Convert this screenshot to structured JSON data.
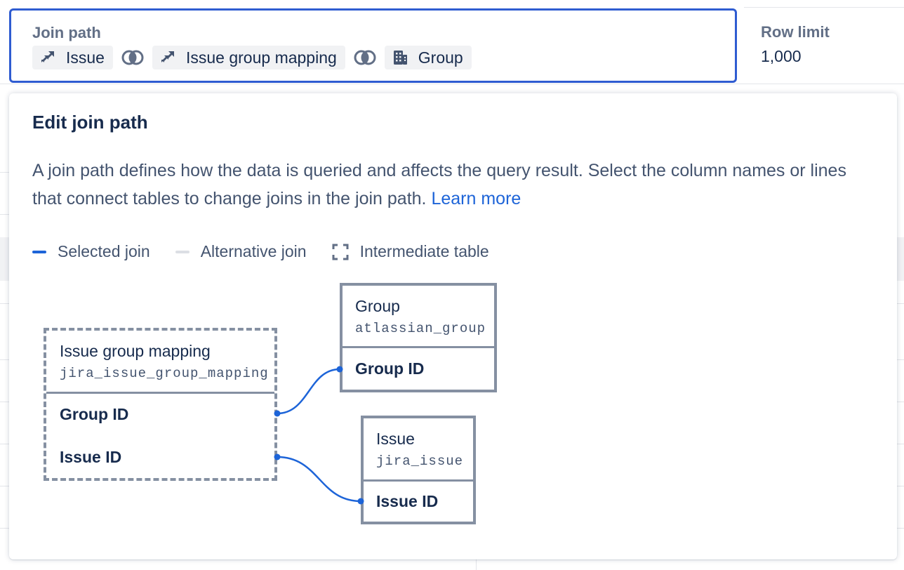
{
  "toolbar": {
    "join_path_label": "Join path",
    "chips": [
      {
        "label": "Issue",
        "icon": "jira-icon"
      },
      {
        "label": "Issue group mapping",
        "icon": "jira-icon"
      },
      {
        "label": "Group",
        "icon": "building-icon"
      }
    ],
    "row_limit_label": "Row limit",
    "row_limit_value": "1,000"
  },
  "popup": {
    "title": "Edit join path",
    "description": "A join path defines how the data is queried and affects the query result. Select the column names or lines that connect tables to change joins in the join path.",
    "learn_more": "Learn more",
    "legend": {
      "selected": "Selected join",
      "alternative": "Alternative join",
      "intermediate": "Intermediate table"
    }
  },
  "diagram": {
    "mapping": {
      "name": "Issue group mapping",
      "code": "jira_issue_group_mapping",
      "columns": [
        "Group ID",
        "Issue ID"
      ]
    },
    "group": {
      "name": "Group",
      "code": "atlassian_group",
      "column": "Group ID"
    },
    "issue": {
      "name": "Issue",
      "code": "jira_issue",
      "column": "Issue ID"
    }
  },
  "colors": {
    "accent": "#2f5cd1",
    "selected_join": "#1d64d8",
    "alternative_join": "#dcdfe4",
    "table_border": "#8590a2",
    "link": "#1d64d8"
  }
}
